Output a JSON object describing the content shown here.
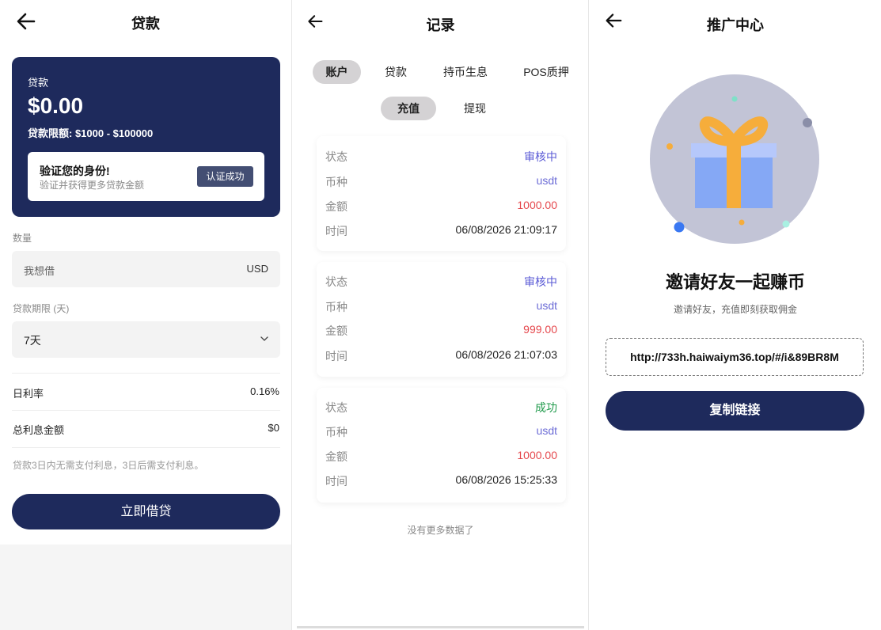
{
  "loan": {
    "title": "贷款",
    "card": {
      "label": "贷款",
      "amount": "$0.00",
      "limit": "贷款限额: $1000 - $100000",
      "verify_title": "验证您的身份!",
      "verify_sub": "验证并获得更多贷款金额",
      "verify_button": "认证成功"
    },
    "quantity_label": "数量",
    "quantity_placeholder": "我想借",
    "quantity_unit": "USD",
    "term_label": "贷款期限 (天)",
    "term_value": "7天",
    "daily_rate_label": "日利率",
    "daily_rate_value": "0.16%",
    "total_interest_label": "总利息金额",
    "total_interest_value": "$0",
    "note": "贷款3日内无需支付利息，3日后需支付利息。",
    "submit": "立即借贷"
  },
  "records": {
    "title": "记录",
    "tabs": [
      "账户",
      "贷款",
      "持币生息",
      "POS质押"
    ],
    "subtabs": [
      "充值",
      "提现"
    ],
    "field_labels": {
      "status": "状态",
      "currency": "币种",
      "amount": "金额",
      "time": "时间"
    },
    "items": [
      {
        "status": "审核中",
        "currency": "usdt",
        "amount": "1000.00",
        "time": "06/08/2026 21:09:17"
      },
      {
        "status": "审核中",
        "currency": "usdt",
        "amount": "999.00",
        "time": "06/08/2026 21:07:03"
      },
      {
        "status": "成功",
        "currency": "usdt",
        "amount": "1000.00",
        "time": "06/08/2026 15:25:33"
      }
    ],
    "no_more": "没有更多数据了"
  },
  "promo": {
    "title": "推广中心",
    "headline": "邀请好友一起赚币",
    "subline": "邀请好友，充值即刻获取佣金",
    "link": "http://733h.haiwaiym36.top/#/i&89BR8M",
    "copy_button": "复制链接"
  },
  "colors": {
    "navy": "#1e2a5c",
    "pending": "#5b5bd6",
    "success": "#1f9a4b",
    "amount_red": "#e5484d",
    "currency_purple": "#6b6bd6"
  }
}
